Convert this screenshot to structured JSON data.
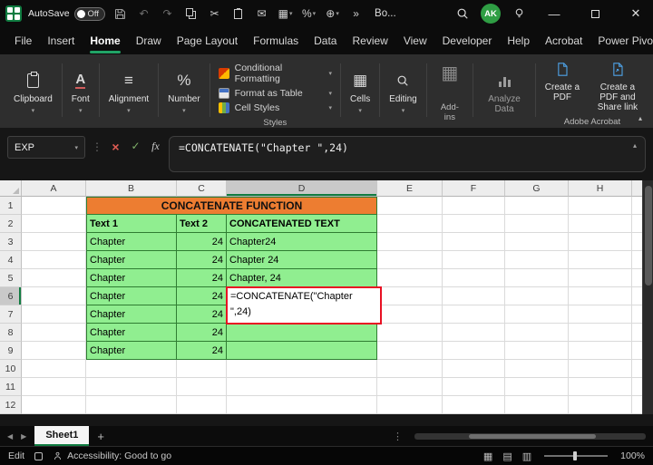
{
  "colors": {
    "excel_green": "#107C41",
    "accent_green": "#21A366",
    "title_orange": "#ED7D31",
    "cell_green": "#90EE90",
    "edit_border_red": "#E81123",
    "selected_header_gray": "#C9C9C9"
  },
  "icons": {
    "chevron_down": "▾",
    "chevron_up": "▴",
    "undo": "↶",
    "redo": "↷",
    "cut": "✂",
    "mail": "✉",
    "grid": "▦",
    "percent": "%",
    "plus": "⊕",
    "more": "»",
    "ellipsis_v": "⋮",
    "cancel": "×",
    "confirm": "✓",
    "fx": "fx",
    "font": "A",
    "alignment": "≡",
    "cells": "▦",
    "addins": "▦",
    "prev": "◀",
    "next": "▶",
    "add_sheet": "+",
    "view_normal": "▦",
    "view_layout": "▤",
    "view_break": "▥"
  },
  "titlebar": {
    "autosave_label": "AutoSave",
    "autosave_state": "Off",
    "workbook_name": "Bo...",
    "avatar_initials": "AK"
  },
  "menubar": {
    "tabs": [
      "File",
      "Insert",
      "Home",
      "Draw",
      "Page Layout",
      "Formulas",
      "Data",
      "Review",
      "View",
      "Developer",
      "Help",
      "Acrobat",
      "Power Pivot"
    ],
    "active_tab": "Home"
  },
  "ribbon": {
    "left_groups": [
      "Clipboard",
      "Font",
      "Alignment",
      "Number"
    ],
    "styles": {
      "label": "Styles",
      "items": [
        "Conditional Formatting",
        "Format as Table",
        "Cell Styles"
      ]
    },
    "mid_groups": [
      "Cells",
      "Editing"
    ],
    "addins_label": "Add-ins",
    "analyze_label": "Analyze Data",
    "acrobat": {
      "label": "Adobe Acrobat",
      "buttons": [
        "Create a PDF",
        "Create a PDF and Share link"
      ]
    }
  },
  "formula_bar": {
    "name_box": "EXP",
    "formula": "=CONCATENATE(\"Chapter \",24)"
  },
  "grid": {
    "columns": [
      "A",
      "B",
      "C",
      "D",
      "E",
      "F",
      "G",
      "H"
    ],
    "selected_column": "D",
    "row_numbers": [
      "1",
      "2",
      "3",
      "4",
      "5",
      "6",
      "7",
      "8",
      "9",
      "10",
      "11",
      "12"
    ],
    "title": "CONCATENATE FUNCTION",
    "headers": {
      "text1": "Text 1",
      "text2": "Text 2",
      "result": "CONCATENATED TEXT"
    },
    "data": [
      {
        "text": "Chapter",
        "num": "24",
        "result": "Chapter24"
      },
      {
        "text": "Chapter",
        "num": "24",
        "result": "Chapter 24"
      },
      {
        "text": "Chapter",
        "num": "24",
        "result": "Chapter, 24"
      },
      {
        "text": "Chapter",
        "num": "24",
        "result": ""
      },
      {
        "text": "Chapter",
        "num": "24",
        "result": ""
      },
      {
        "text": "Chapter",
        "num": "24",
        "result": ""
      },
      {
        "text": "Chapter",
        "num": "24",
        "result": ""
      }
    ],
    "edit": {
      "line1": "=CONCATENATE(\"Chapter",
      "line2": "\",24)"
    }
  },
  "sheet_bar": {
    "active_tab": "Sheet1"
  },
  "status_bar": {
    "mode": "Edit",
    "accessibility": "Accessibility: Good to go",
    "zoom": "100%"
  }
}
